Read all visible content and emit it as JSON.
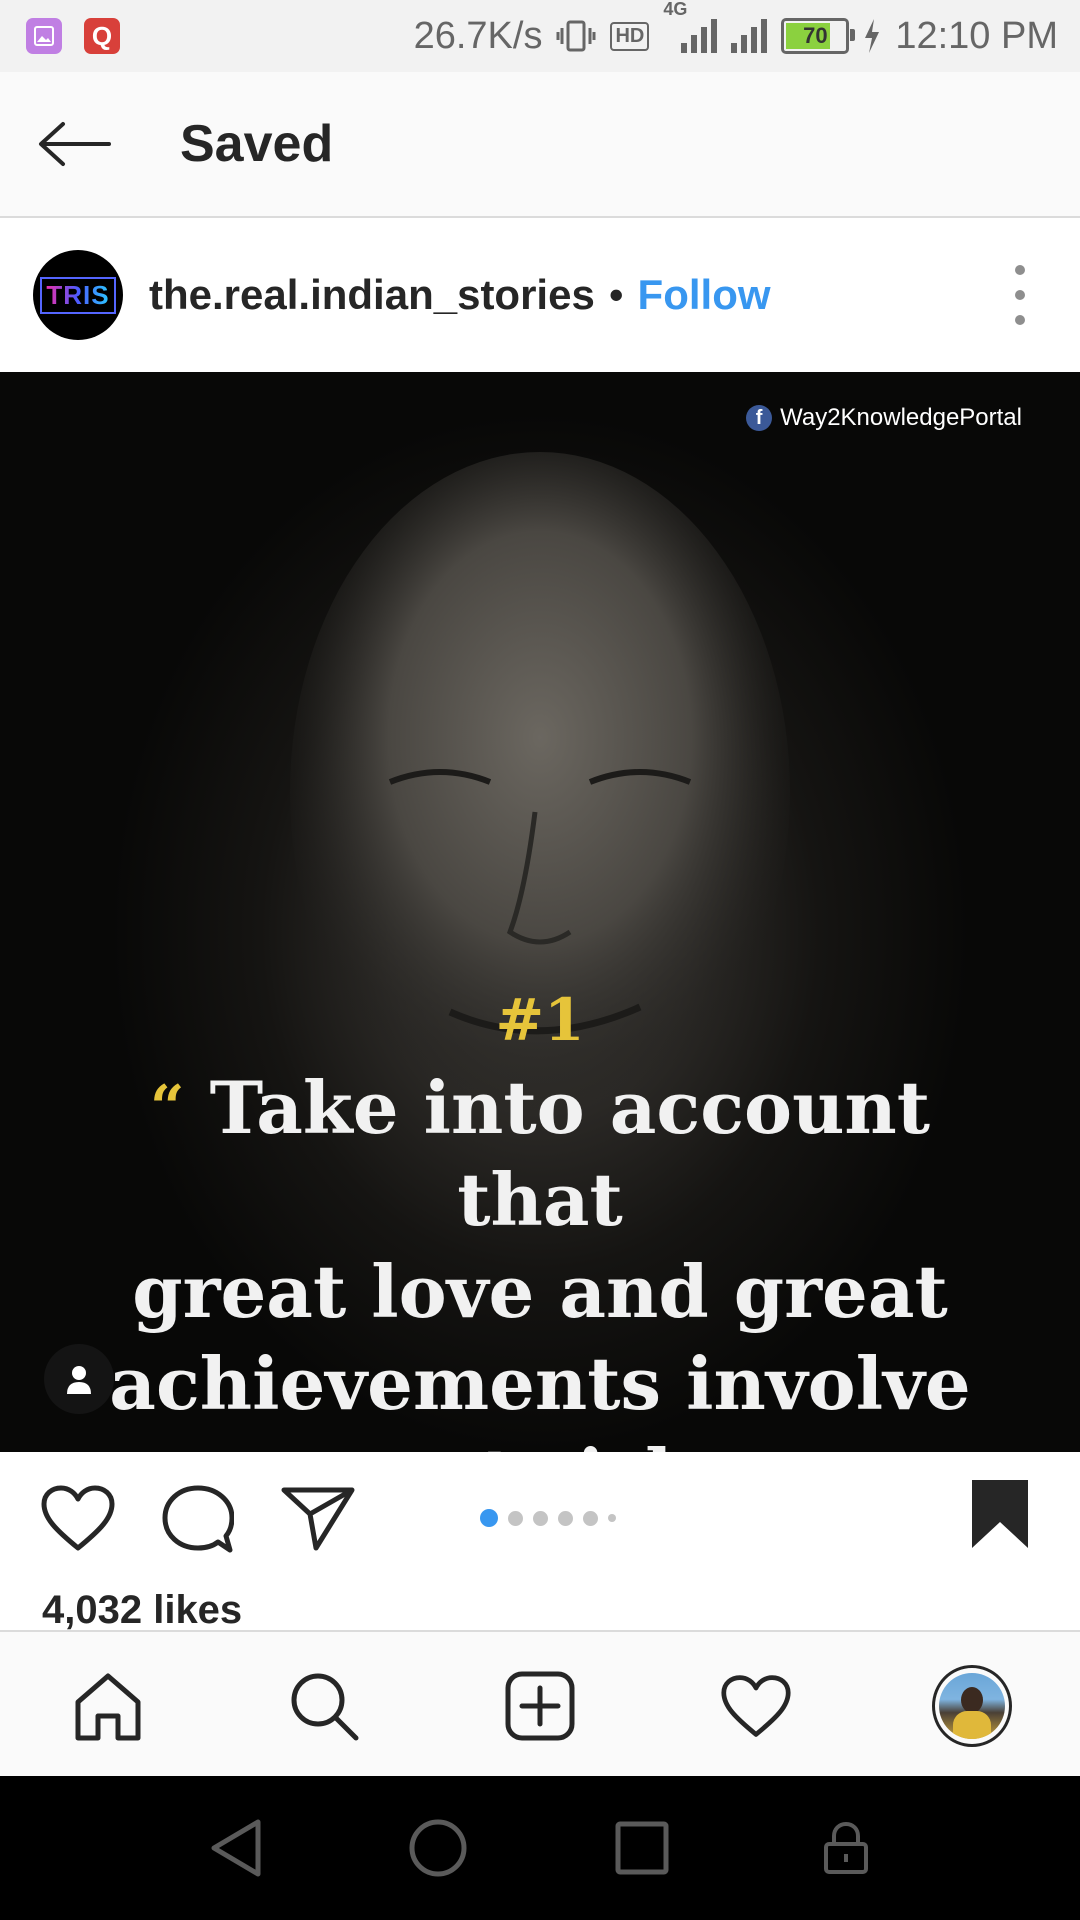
{
  "status_bar": {
    "network_speed": "26.7K/s",
    "hd_label": "HD",
    "network_type": "4G",
    "battery_level": "70",
    "time": "12:10 PM"
  },
  "header": {
    "title": "Saved"
  },
  "post": {
    "avatar_text": "TRIS",
    "username": "the.real.indian_stories",
    "separator": "•",
    "follow_label": "Follow",
    "image": {
      "watermark_icon": "f",
      "watermark": "Way2KnowledgePortal",
      "rank": "#1",
      "quote_open": "“",
      "quote_lines": [
        "Take into account that",
        "great love and great",
        "achievements involve",
        "great risk."
      ],
      "quote_close": "”"
    },
    "carousel": {
      "total": 6,
      "active_index": 0
    },
    "likes": "4,032 likes",
    "icons": {
      "like": "heart-outline-icon",
      "comment": "comment-icon",
      "share": "send-icon",
      "save": "bookmark-filled-icon"
    }
  },
  "bottom_nav": {
    "items": [
      "home-icon",
      "search-icon",
      "add-post-icon",
      "activity-heart-icon",
      "profile-avatar"
    ]
  },
  "colors": {
    "accent": "#3897f0",
    "quote_gold": "#e6c43a",
    "battery_green": "#8bd13f"
  }
}
